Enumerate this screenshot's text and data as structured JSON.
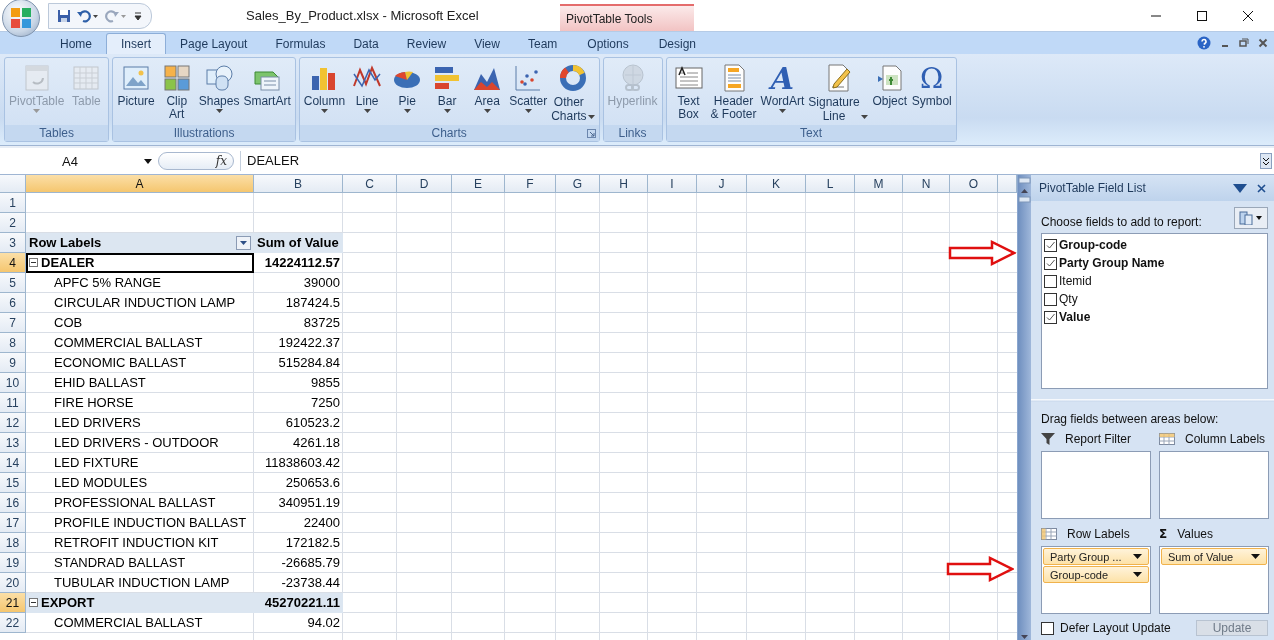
{
  "window": {
    "title": "Sales_By_Product.xlsx - Microsoft Excel",
    "contextual_group": "PivotTable Tools"
  },
  "ribbon_tabs": [
    {
      "label": "Home",
      "selected": false
    },
    {
      "label": "Insert",
      "selected": true
    },
    {
      "label": "Page Layout",
      "selected": false
    },
    {
      "label": "Formulas",
      "selected": false
    },
    {
      "label": "Data",
      "selected": false
    },
    {
      "label": "Review",
      "selected": false
    },
    {
      "label": "View",
      "selected": false
    },
    {
      "label": "Team",
      "selected": false
    }
  ],
  "contextual_tabs": [
    {
      "label": "Options",
      "selected": false
    },
    {
      "label": "Design",
      "selected": false
    }
  ],
  "ribbon_groups": [
    {
      "label": "Tables",
      "launcher": false,
      "commands": [
        {
          "label": "PivotTable",
          "disabled": true,
          "dropdown": true
        },
        {
          "label": "Table",
          "disabled": true,
          "dropdown": false
        }
      ]
    },
    {
      "label": "Illustrations",
      "launcher": false,
      "commands": [
        {
          "label": "Picture",
          "disabled": false,
          "dropdown": false
        },
        {
          "label": "Clip\nArt",
          "disabled": false,
          "dropdown": false
        },
        {
          "label": "Shapes",
          "disabled": false,
          "dropdown": true
        },
        {
          "label": "SmartArt",
          "disabled": false,
          "dropdown": false
        }
      ]
    },
    {
      "label": "Charts",
      "launcher": true,
      "commands": [
        {
          "label": "Column",
          "disabled": false,
          "dropdown": true
        },
        {
          "label": "Line",
          "disabled": false,
          "dropdown": true
        },
        {
          "label": "Pie",
          "disabled": false,
          "dropdown": true
        },
        {
          "label": "Bar",
          "disabled": false,
          "dropdown": true
        },
        {
          "label": "Area",
          "disabled": false,
          "dropdown": true
        },
        {
          "label": "Scatter",
          "disabled": false,
          "dropdown": true
        },
        {
          "label": "Other\nCharts",
          "disabled": false,
          "dropdown": true
        }
      ]
    },
    {
      "label": "Links",
      "launcher": false,
      "commands": [
        {
          "label": "Hyperlink",
          "disabled": true,
          "dropdown": false
        }
      ]
    },
    {
      "label": "Text",
      "launcher": false,
      "commands": [
        {
          "label": "Text\nBox",
          "disabled": false,
          "dropdown": false
        },
        {
          "label": "Header\n& Footer",
          "disabled": false,
          "dropdown": false
        },
        {
          "label": "WordArt",
          "disabled": false,
          "dropdown": true,
          "glyph": "A"
        },
        {
          "label": "Signature\nLine",
          "disabled": false,
          "dropdown": true
        },
        {
          "label": "Object",
          "disabled": false,
          "dropdown": false
        },
        {
          "label": "Symbol",
          "disabled": false,
          "dropdown": false,
          "glyph": "Ω"
        }
      ]
    }
  ],
  "formula_bar": {
    "name_box": "A4",
    "fx": "fx",
    "formula": "DEALER"
  },
  "columns": [
    {
      "label": "A",
      "selected": true
    },
    {
      "label": "B",
      "selected": false
    },
    {
      "label": "C",
      "selected": false
    },
    {
      "label": "D",
      "selected": false
    },
    {
      "label": "E",
      "selected": false
    },
    {
      "label": "F",
      "selected": false
    },
    {
      "label": "G",
      "selected": false
    },
    {
      "label": "H",
      "selected": false
    },
    {
      "label": "I",
      "selected": false
    },
    {
      "label": "J",
      "selected": false
    },
    {
      "label": "K",
      "selected": false
    },
    {
      "label": "L",
      "selected": false
    },
    {
      "label": "M",
      "selected": false
    },
    {
      "label": "N",
      "selected": false
    },
    {
      "label": "O",
      "selected": false
    }
  ],
  "rows": [
    {
      "number": "1",
      "kind": "blank",
      "selected": false
    },
    {
      "number": "2",
      "kind": "blank",
      "selected": false
    },
    {
      "number": "3",
      "kind": "header",
      "selected": false,
      "label": "Row Labels",
      "value": "Sum of Value"
    },
    {
      "number": "4",
      "kind": "group",
      "selected": true,
      "active": true,
      "expanded": true,
      "label": "DEALER",
      "value": "14224112.57"
    },
    {
      "number": "5",
      "kind": "item",
      "selected": false,
      "label": "APFC 5% RANGE",
      "value": "39000"
    },
    {
      "number": "6",
      "kind": "item",
      "selected": false,
      "label": "CIRCULAR INDUCTION LAMP",
      "value": "187424.5"
    },
    {
      "number": "7",
      "kind": "item",
      "selected": false,
      "label": "COB",
      "value": "83725"
    },
    {
      "number": "8",
      "kind": "item",
      "selected": false,
      "label": "COMMERCIAL BALLAST",
      "value": "192422.37"
    },
    {
      "number": "9",
      "kind": "item",
      "selected": false,
      "label": "ECONOMIC BALLAST",
      "value": "515284.84"
    },
    {
      "number": "10",
      "kind": "item",
      "selected": false,
      "label": "EHID BALLAST",
      "value": "9855"
    },
    {
      "number": "11",
      "kind": "item",
      "selected": false,
      "label": "FIRE HORSE",
      "value": "7250"
    },
    {
      "number": "12",
      "kind": "item",
      "selected": false,
      "label": "LED DRIVERS",
      "value": "610523.2"
    },
    {
      "number": "13",
      "kind": "item",
      "selected": false,
      "label": "LED DRIVERS - OUTDOOR",
      "value": "4261.18"
    },
    {
      "number": "14",
      "kind": "item",
      "selected": false,
      "label": "LED FIXTURE",
      "value": "11838603.42"
    },
    {
      "number": "15",
      "kind": "item",
      "selected": false,
      "label": "LED MODULES",
      "value": "250653.6"
    },
    {
      "number": "16",
      "kind": "item",
      "selected": false,
      "label": "PROFESSIONAL BALLAST",
      "value": "340951.19"
    },
    {
      "number": "17",
      "kind": "item",
      "selected": false,
      "label": "PROFILE INDUCTION  BALLAST",
      "value": "22400"
    },
    {
      "number": "18",
      "kind": "item",
      "selected": false,
      "label": "RETROFIT INDUCTION  KIT",
      "value": "172182.5"
    },
    {
      "number": "19",
      "kind": "item",
      "selected": false,
      "label": "STANDRAD BALLAST",
      "value": "-26685.79"
    },
    {
      "number": "20",
      "kind": "item",
      "selected": false,
      "label": "TUBULAR INDUCTION LAMP",
      "value": "-23738.44"
    },
    {
      "number": "21",
      "kind": "group",
      "selected": true,
      "active": false,
      "expanded": true,
      "label": "EXPORT",
      "value": "45270221.11"
    },
    {
      "number": "22",
      "kind": "item",
      "selected": false,
      "label": "COMMERCIAL BALLAST",
      "value": "94.02"
    }
  ],
  "field_list": {
    "title": "PivotTable Field List",
    "prompt": "Choose fields to add to report:",
    "fields": [
      {
        "label": "Group-code",
        "checked": true
      },
      {
        "label": "Party Group Name",
        "checked": true
      },
      {
        "label": "Itemid",
        "checked": false
      },
      {
        "label": "Qty",
        "checked": false
      },
      {
        "label": "Value",
        "checked": true
      }
    ],
    "areas_prompt": "Drag fields between areas below:",
    "areas": [
      {
        "kind": "filter",
        "label": "Report Filter"
      },
      {
        "kind": "columns",
        "label": "Column Labels"
      },
      {
        "kind": "rows",
        "label": "Row Labels",
        "items": [
          "Party Group ...",
          "Group-code"
        ]
      },
      {
        "kind": "values",
        "label": "Values",
        "glyph": "Σ",
        "items": [
          "Sum of Value"
        ]
      }
    ],
    "defer_update": {
      "label": "Defer Layout Update",
      "checked": false
    },
    "update_button": {
      "label": "Update",
      "disabled": true
    }
  }
}
